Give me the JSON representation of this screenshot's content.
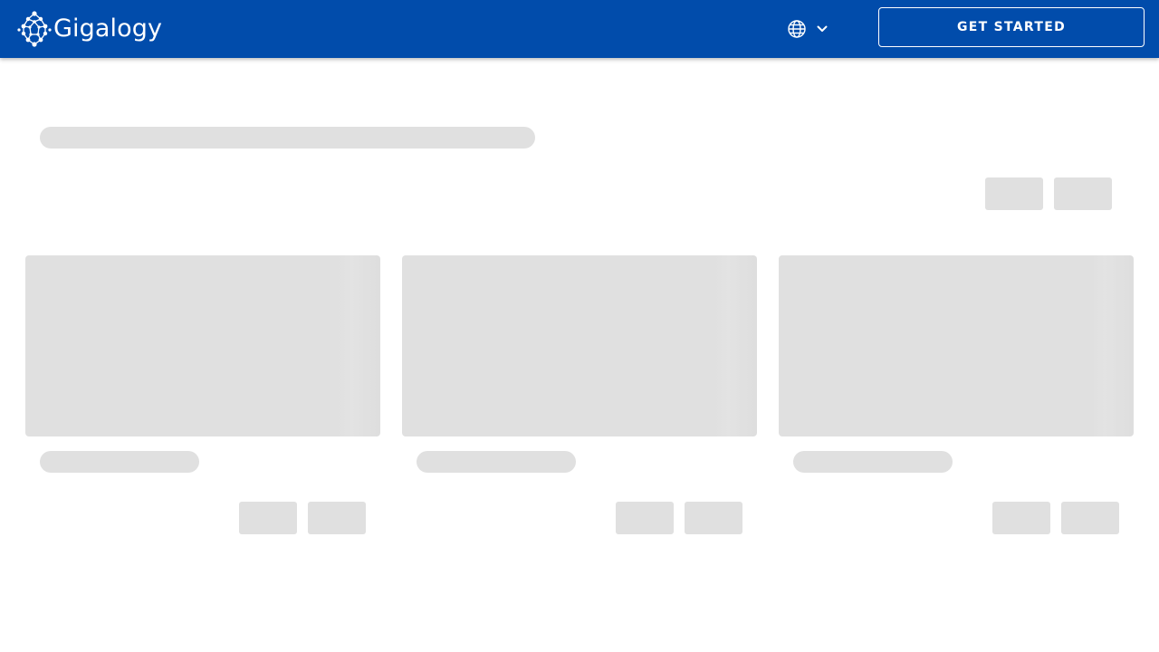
{
  "header": {
    "logo": {
      "text": "Gigalogy",
      "icon": "network-dots-logo"
    },
    "language": {
      "globe_icon": "globe-icon",
      "chevron_icon": "chevron-down-icon"
    },
    "cta_label": "Get Started"
  },
  "colors": {
    "header_bg": "#014cab",
    "skeleton": "#e0e0e0",
    "text_on_header": "#ffffff"
  },
  "content": {
    "state": "loading",
    "card_count": 3,
    "cards": [
      {
        "id": "card-1"
      },
      {
        "id": "card-2"
      },
      {
        "id": "card-3"
      }
    ]
  }
}
